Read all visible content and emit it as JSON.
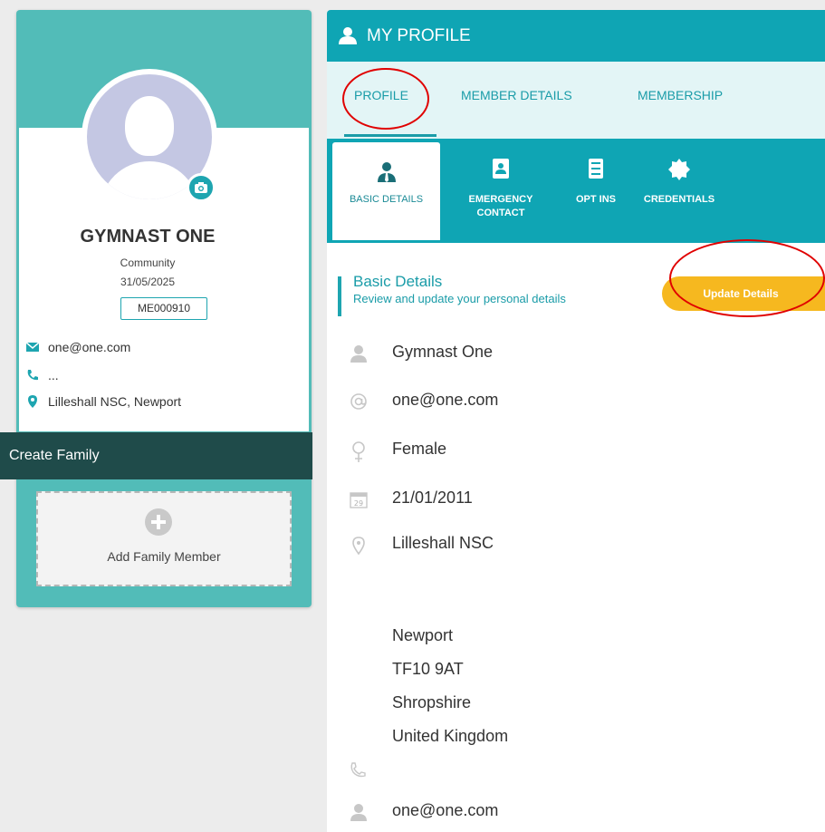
{
  "user": {
    "name": "GYMNAST ONE",
    "membership_type": "Community",
    "expiry_date": "31/05/2025",
    "member_id": "ME000910",
    "email": "one@one.com",
    "phone": "...",
    "location": "Lilleshall NSC, Newport"
  },
  "family": {
    "header": "Create Family",
    "add_label": "Add Family Member"
  },
  "page": {
    "title": "MY PROFILE"
  },
  "tabs": [
    {
      "label": "PROFILE",
      "active": true
    },
    {
      "label": "MEMBER DETAILS",
      "active": false
    },
    {
      "label": "MEMBERSHIP",
      "active": false
    }
  ],
  "subtabs": [
    {
      "label": "BASIC DETAILS",
      "icon": "person-tie-icon",
      "active": true
    },
    {
      "label_line1": "EMERGENCY",
      "label_line2": "CONTACT",
      "icon": "contact-book-icon",
      "active": false
    },
    {
      "label": "OPT INS",
      "icon": "checklist-icon",
      "active": false
    },
    {
      "label": "CREDENTIALS",
      "icon": "badge-icon",
      "active": false
    }
  ],
  "section": {
    "title": "Basic Details",
    "subtitle": "Review and update your personal details",
    "update_button": "Update Details"
  },
  "details": {
    "full_name": "Gymnast One",
    "email": "one@one.com",
    "gender": "Female",
    "dob": "21/01/2011",
    "calendar_day": "29",
    "address_line1": "Lilleshall NSC",
    "address_town": "Newport",
    "address_postcode": "TF10 9AT",
    "address_county": "Shropshire",
    "address_country": "United Kingdom",
    "phone": "",
    "contact_email": "one@one.com"
  },
  "colors": {
    "teal": "#0fa5b4",
    "left_card": "#52bcb8",
    "dark_header": "#1f4b4a",
    "accent_yellow": "#f6b81f",
    "annotation_red": "#e00000"
  }
}
